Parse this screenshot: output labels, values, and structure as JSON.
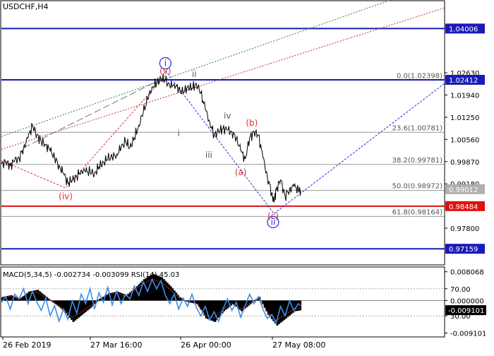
{
  "window": {
    "symbol": "USDCHF,H4"
  },
  "indicator": {
    "label": "MACD(5,34,5) -0.002734 -0.003099 RSI(14) 45.03"
  },
  "colors": {
    "price": "#000000",
    "level_blue": "#1a1ab8",
    "level_red": "#e01010",
    "fib_line": "#9a9a9a",
    "wave_red": "#e0302a",
    "wave_blue": "#2a2ad8",
    "wave_gray": "#5a5a5a",
    "macd_line": "#3a8ee6",
    "label_box_blue": "#1a1ab8",
    "label_box_red": "#e01010",
    "label_box_gray": "#b0b0b0"
  },
  "chart_data": [
    {
      "type": "line",
      "title": "USDCHF,H4",
      "x_ticks": [
        "26 Feb 2019",
        "27 Mar 16:00",
        "26 Apr 00:00",
        "27 May 08:00"
      ],
      "y_ticks": [
        "1.02630",
        "1.01940",
        "1.01250",
        "1.00560",
        "0.99870",
        "0.99180",
        "0.97800"
      ],
      "ylim": [
        0.9668,
        1.0485
      ],
      "levels": [
        {
          "value": 1.04006,
          "label": "1.04006",
          "color": "blue"
        },
        {
          "value": 1.02412,
          "label": "1.02412",
          "color": "blue"
        },
        {
          "value": 0.98484,
          "label": "0.98484",
          "color": "red"
        },
        {
          "value": 0.97159,
          "label": "0.97159",
          "color": "blue"
        },
        {
          "value": 0.99012,
          "label": "0.99012",
          "color": "gray"
        }
      ],
      "fibonacci": [
        {
          "value": 1.02398,
          "label": "0.0(1.02398)"
        },
        {
          "value": 1.00781,
          "label": "23.6(1.00781)"
        },
        {
          "value": 0.99781,
          "label": "38.2(0.99781)"
        },
        {
          "value": 0.98972,
          "label": "50.0(0.98972)"
        },
        {
          "value": 0.98164,
          "label": "61.8(0.98164)"
        }
      ],
      "wave_labels": [
        {
          "text": "i",
          "x": 0.37,
          "y": 1.0284,
          "color": "blue",
          "circled": true
        },
        {
          "text": "(v)",
          "x": 0.37,
          "y": 1.026,
          "color": "red",
          "circled": false
        },
        {
          "text": "ii",
          "x": 0.435,
          "y": 1.025,
          "color": "gray",
          "circled": false
        },
        {
          "text": "i",
          "x": 0.4,
          "y": 1.0065,
          "color": "gray",
          "circled": false
        },
        {
          "text": "iv",
          "x": 0.51,
          "y": 1.012,
          "color": "gray",
          "circled": false
        },
        {
          "text": "iii",
          "x": 0.468,
          "y": 0.9998,
          "color": "gray",
          "circled": false
        },
        {
          "text": "(b)",
          "x": 0.565,
          "y": 1.0098,
          "color": "red",
          "circled": false
        },
        {
          "text": "(a)",
          "x": 0.54,
          "y": 0.9945,
          "color": "red",
          "circled": false
        },
        {
          "text": "(c)",
          "x": 0.613,
          "y": 0.9809,
          "color": "red",
          "circled": false
        },
        {
          "text": "ii",
          "x": 0.613,
          "y": 0.979,
          "color": "blue",
          "circled": true
        },
        {
          "text": "(iv)",
          "x": 0.145,
          "y": 0.987,
          "color": "red",
          "circled": false
        }
      ],
      "price_path": [
        [
          0.0,
          0.998
        ],
        [
          0.01,
          0.9985
        ],
        [
          0.02,
          0.9975
        ],
        [
          0.03,
          0.999
        ],
        [
          0.04,
          0.9998
        ],
        [
          0.05,
          1.003
        ],
        [
          0.06,
          1.006
        ],
        [
          0.07,
          1.01
        ],
        [
          0.08,
          1.007
        ],
        [
          0.09,
          1.005
        ],
        [
          0.1,
          1.004
        ],
        [
          0.11,
          1.002
        ],
        [
          0.12,
          1.0
        ],
        [
          0.13,
          0.9975
        ],
        [
          0.14,
          0.995
        ],
        [
          0.15,
          0.992
        ],
        [
          0.16,
          0.993
        ],
        [
          0.17,
          0.994
        ],
        [
          0.18,
          0.996
        ],
        [
          0.19,
          0.9955
        ],
        [
          0.2,
          0.9955
        ],
        [
          0.21,
          0.995
        ],
        [
          0.22,
          0.997
        ],
        [
          0.23,
          0.9985
        ],
        [
          0.24,
          0.9995
        ],
        [
          0.25,
          1.0
        ],
        [
          0.26,
          1.001
        ],
        [
          0.27,
          1.003
        ],
        [
          0.28,
          1.005
        ],
        [
          0.29,
          1.003
        ],
        [
          0.3,
          1.006
        ],
        [
          0.31,
          1.01
        ],
        [
          0.32,
          1.014
        ],
        [
          0.33,
          1.018
        ],
        [
          0.34,
          1.022
        ],
        [
          0.35,
          1.023
        ],
        [
          0.36,
          1.0245
        ],
        [
          0.37,
          1.024
        ],
        [
          0.38,
          1.022
        ],
        [
          0.39,
          1.023
        ],
        [
          0.4,
          1.021
        ],
        [
          0.41,
          1.02
        ],
        [
          0.42,
          1.022
        ],
        [
          0.43,
          1.0215
        ],
        [
          0.44,
          1.023
        ],
        [
          0.45,
          1.02
        ],
        [
          0.46,
          1.015
        ],
        [
          0.47,
          1.011
        ],
        [
          0.48,
          1.007
        ],
        [
          0.49,
          1.008
        ],
        [
          0.5,
          1.009
        ],
        [
          0.51,
          1.0085
        ],
        [
          0.52,
          1.008
        ],
        [
          0.53,
          1.006
        ],
        [
          0.54,
          1.002
        ],
        [
          0.55,
          0.9995
        ],
        [
          0.56,
          1.006
        ],
        [
          0.57,
          1.008
        ],
        [
          0.58,
          1.007
        ],
        [
          0.59,
          1.0
        ],
        [
          0.6,
          0.994
        ],
        [
          0.61,
          0.989
        ],
        [
          0.615,
          0.986
        ],
        [
          0.62,
          0.99
        ],
        [
          0.63,
          0.993
        ],
        [
          0.64,
          0.988
        ],
        [
          0.65,
          0.99
        ],
        [
          0.66,
          0.991
        ],
        [
          0.67,
          0.99
        ],
        [
          0.675,
          0.9897
        ]
      ]
    },
    {
      "type": "line",
      "title": "MACD(5,34,5) RSI(14)",
      "y_ticks": [
        "0.008068",
        "70.00",
        "0.000000",
        "30.00",
        "-0.009101"
      ],
      "ylim": [
        -0.01,
        0.009
      ],
      "macd": [
        [
          0.0,
          0.001
        ],
        [
          0.02,
          0.0015
        ],
        [
          0.04,
          0.0005
        ],
        [
          0.06,
          0.0025
        ],
        [
          0.08,
          0.003
        ],
        [
          0.1,
          0.001
        ],
        [
          0.12,
          -0.001
        ],
        [
          0.14,
          -0.003
        ],
        [
          0.16,
          -0.006
        ],
        [
          0.18,
          -0.004
        ],
        [
          0.2,
          -0.002
        ],
        [
          0.22,
          0.0005
        ],
        [
          0.24,
          0.002
        ],
        [
          0.26,
          0.0025
        ],
        [
          0.28,
          0.0015
        ],
        [
          0.3,
          0.0035
        ],
        [
          0.32,
          0.006
        ],
        [
          0.34,
          0.0075
        ],
        [
          0.36,
          0.0065
        ],
        [
          0.38,
          0.004
        ],
        [
          0.4,
          0.001
        ],
        [
          0.42,
          -0.0005
        ],
        [
          0.44,
          -0.001
        ],
        [
          0.46,
          -0.005
        ],
        [
          0.48,
          -0.006
        ],
        [
          0.5,
          -0.003
        ],
        [
          0.52,
          -0.001
        ],
        [
          0.54,
          -0.003
        ],
        [
          0.56,
          -0.001
        ],
        [
          0.58,
          0.001
        ],
        [
          0.6,
          -0.004
        ],
        [
          0.62,
          -0.007
        ],
        [
          0.64,
          -0.005
        ],
        [
          0.66,
          -0.003
        ],
        [
          0.675,
          -0.0027
        ]
      ],
      "rsi": [
        [
          0.0,
          50
        ],
        [
          0.01,
          58
        ],
        [
          0.02,
          40
        ],
        [
          0.03,
          62
        ],
        [
          0.04,
          55
        ],
        [
          0.05,
          70
        ],
        [
          0.06,
          48
        ],
        [
          0.07,
          66
        ],
        [
          0.08,
          50
        ],
        [
          0.09,
          38
        ],
        [
          0.1,
          56
        ],
        [
          0.11,
          30
        ],
        [
          0.12,
          45
        ],
        [
          0.13,
          22
        ],
        [
          0.14,
          40
        ],
        [
          0.15,
          25
        ],
        [
          0.16,
          52
        ],
        [
          0.17,
          34
        ],
        [
          0.18,
          62
        ],
        [
          0.19,
          48
        ],
        [
          0.2,
          70
        ],
        [
          0.21,
          40
        ],
        [
          0.22,
          64
        ],
        [
          0.23,
          50
        ],
        [
          0.24,
          72
        ],
        [
          0.25,
          46
        ],
        [
          0.26,
          66
        ],
        [
          0.27,
          48
        ],
        [
          0.28,
          62
        ],
        [
          0.29,
          55
        ],
        [
          0.3,
          74
        ],
        [
          0.31,
          60
        ],
        [
          0.32,
          80
        ],
        [
          0.33,
          66
        ],
        [
          0.34,
          84
        ],
        [
          0.35,
          70
        ],
        [
          0.36,
          82
        ],
        [
          0.37,
          60
        ],
        [
          0.38,
          48
        ],
        [
          0.39,
          62
        ],
        [
          0.4,
          40
        ],
        [
          0.41,
          56
        ],
        [
          0.42,
          44
        ],
        [
          0.43,
          62
        ],
        [
          0.44,
          42
        ],
        [
          0.45,
          30
        ],
        [
          0.46,
          44
        ],
        [
          0.47,
          24
        ],
        [
          0.48,
          36
        ],
        [
          0.49,
          22
        ],
        [
          0.5,
          40
        ],
        [
          0.51,
          55
        ],
        [
          0.52,
          38
        ],
        [
          0.53,
          50
        ],
        [
          0.54,
          28
        ],
        [
          0.55,
          45
        ],
        [
          0.56,
          62
        ],
        [
          0.57,
          48
        ],
        [
          0.58,
          58
        ],
        [
          0.59,
          40
        ],
        [
          0.6,
          26
        ],
        [
          0.61,
          32
        ],
        [
          0.62,
          20
        ],
        [
          0.63,
          44
        ],
        [
          0.64,
          30
        ],
        [
          0.65,
          52
        ],
        [
          0.66,
          38
        ],
        [
          0.67,
          48
        ],
        [
          0.675,
          45
        ]
      ]
    }
  ]
}
